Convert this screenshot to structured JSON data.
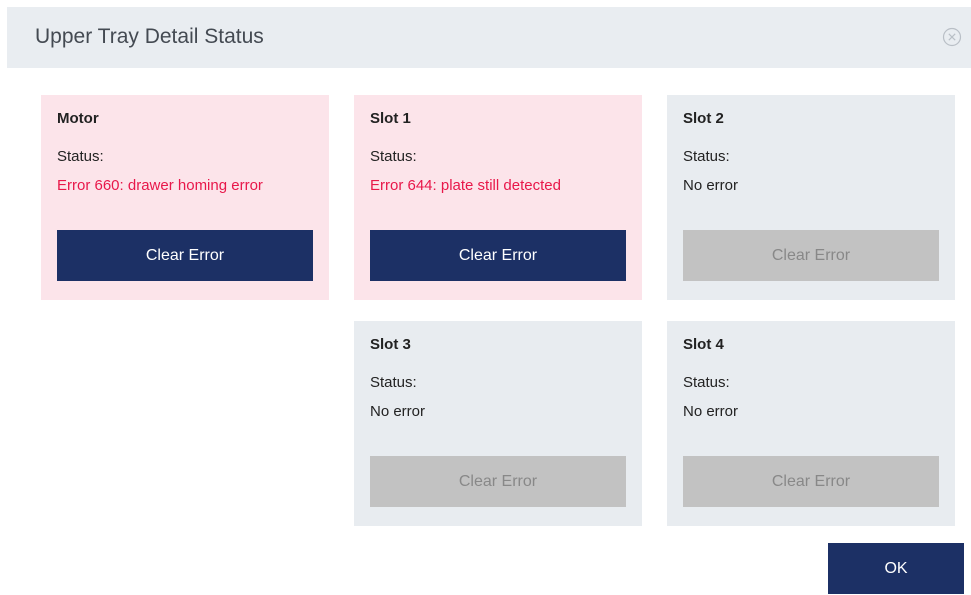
{
  "dialog": {
    "title": "Upper Tray Detail Status",
    "close_icon": "close-circle-icon",
    "ok_label": "OK"
  },
  "colors": {
    "header_bg": "#e9edf1",
    "error_card_bg": "#fce4ea",
    "ok_card_bg": "#e8ecf0",
    "error_text": "#e8174a",
    "primary_button": "#1c3065",
    "disabled_button": "#c2c2c2"
  },
  "cards": [
    {
      "title": "Motor",
      "status_label": "Status:",
      "status_value": "Error 660: drawer homing error",
      "state": "error",
      "button_label": "Clear Error",
      "button_enabled": true
    },
    {
      "title": "Slot 1",
      "status_label": "Status:",
      "status_value": "Error 644: plate still detected",
      "state": "error",
      "button_label": "Clear Error",
      "button_enabled": true
    },
    {
      "title": "Slot 2",
      "status_label": "Status:",
      "status_value": "No error",
      "state": "ok",
      "button_label": "Clear Error",
      "button_enabled": false
    },
    {
      "title": "Slot 3",
      "status_label": "Status:",
      "status_value": "No error",
      "state": "ok",
      "button_label": "Clear Error",
      "button_enabled": false
    },
    {
      "title": "Slot 4",
      "status_label": "Status:",
      "status_value": "No error",
      "state": "ok",
      "button_label": "Clear Error",
      "button_enabled": false
    }
  ]
}
